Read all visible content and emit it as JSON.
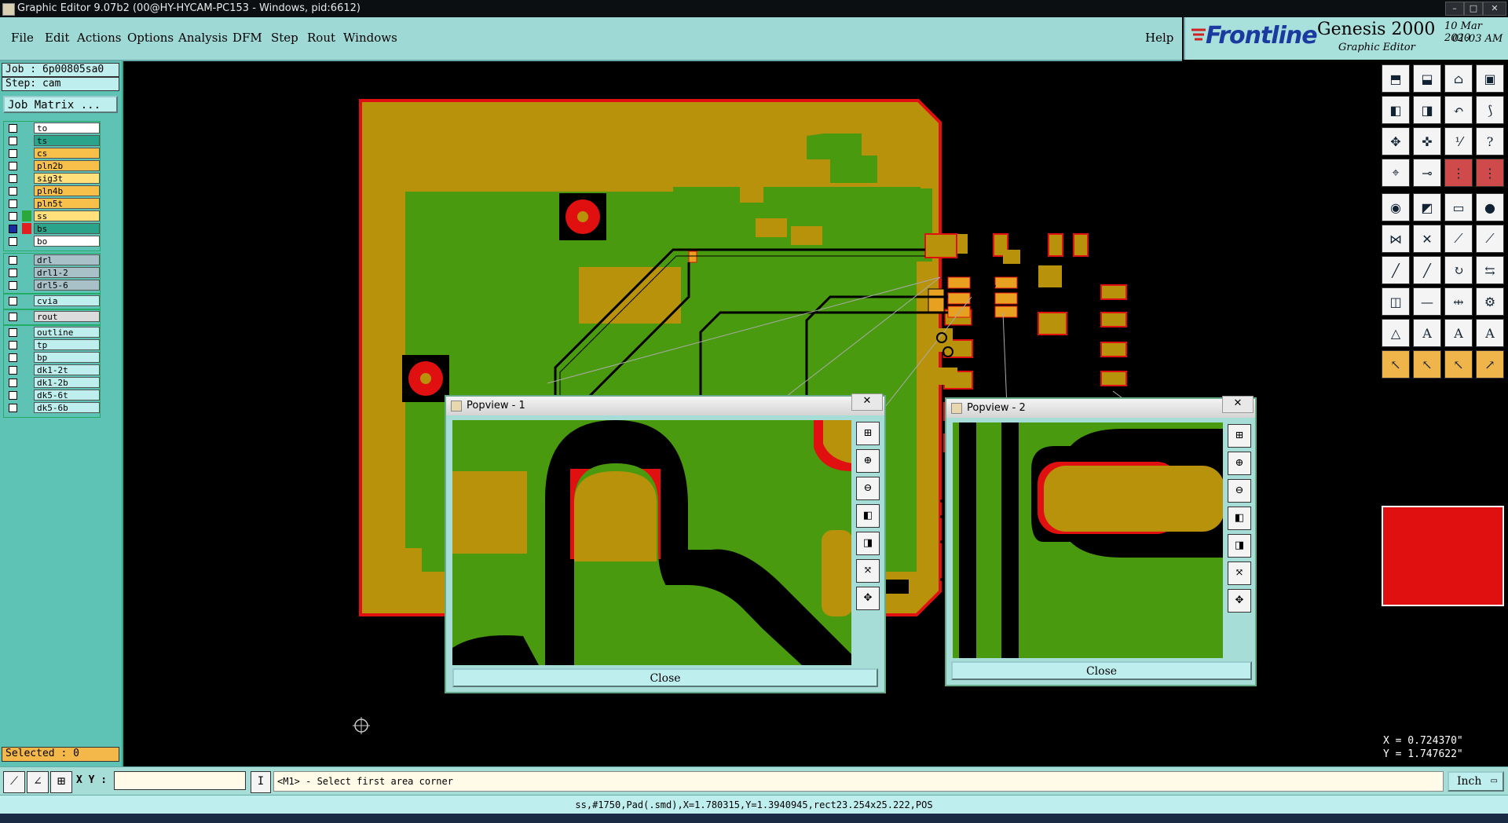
{
  "window_title": "Graphic Editor 9.07b2 (00@HY-HYCAM-PC153 - Windows, pid:6612)",
  "menu": [
    {
      "label": "File"
    },
    {
      "label": "Edit"
    },
    {
      "label": "Actions"
    },
    {
      "label": "Options"
    },
    {
      "label": "Analysis"
    },
    {
      "label": "DFM"
    },
    {
      "label": "Step"
    },
    {
      "label": "Rout"
    },
    {
      "label": "Windows"
    }
  ],
  "help_label": "Help",
  "brand": {
    "logo": "Frontline",
    "product": "Genesis 2000",
    "subtitle": "Graphic Editor",
    "date": "10 Mar 2020",
    "time": "01:03 AM"
  },
  "job": {
    "job_text": "Job : 6p00805sa0",
    "step_text": "Step: cam",
    "matrix_button": "Job Matrix ..."
  },
  "layer_groups": [
    [
      {
        "name": "to",
        "color": "#ffffff",
        "swatch": ""
      },
      {
        "name": "ts",
        "color": "#2aa58c",
        "swatch": ""
      },
      {
        "name": "cs",
        "color": "#f6c04a",
        "swatch": ""
      },
      {
        "name": "pln2b",
        "color": "#f6c04a",
        "swatch": ""
      },
      {
        "name": "sig3t",
        "color": "#ffe07a",
        "swatch": ""
      },
      {
        "name": "pln4b",
        "color": "#f6c04a",
        "swatch": ""
      },
      {
        "name": "pln5t",
        "color": "#f6c04a",
        "swatch": ""
      },
      {
        "name": "ss",
        "color": "#ffe07a",
        "swatch": "#2aa83a"
      },
      {
        "name": "bs",
        "color": "#2aa58c",
        "swatch": "#e02020"
      },
      {
        "name": "bo",
        "color": "#ffffff",
        "swatch": ""
      }
    ],
    [
      {
        "name": "drl",
        "color": "#a8c0c8",
        "swatch": ""
      },
      {
        "name": "drl1-2",
        "color": "#a8c0c8",
        "swatch": ""
      },
      {
        "name": "drl5-6",
        "color": "#a8c0c8",
        "swatch": ""
      }
    ],
    [
      {
        "name": "cvia",
        "color": "#bfeeee",
        "swatch": ""
      }
    ],
    [
      {
        "name": "rout",
        "color": "#dcdcdc",
        "swatch": ""
      }
    ],
    [
      {
        "name": "outline",
        "color": "#bfeeee",
        "swatch": ""
      },
      {
        "name": "tp",
        "color": "#bfeeee",
        "swatch": ""
      },
      {
        "name": "bp",
        "color": "#bfeeee",
        "swatch": ""
      },
      {
        "name": "dk1-2t",
        "color": "#bfeeee",
        "swatch": ""
      },
      {
        "name": "dk1-2b",
        "color": "#bfeeee",
        "swatch": ""
      },
      {
        "name": "dk5-6t",
        "color": "#bfeeee",
        "swatch": ""
      },
      {
        "name": "dk5-6b",
        "color": "#bfeeee",
        "swatch": ""
      }
    ]
  ],
  "selected_text": "Selected : 0",
  "popview1": {
    "title": "Popview - 1",
    "close": "Close"
  },
  "popview2": {
    "title": "Popview - 2",
    "close": "Close"
  },
  "coords": {
    "x": "X = 0.724370\"",
    "y": "Y = 1.747622\""
  },
  "xy_label": "X Y :",
  "prompt": "<M1> - Select first area corner",
  "units": "Inch",
  "status": "ss,#1750,Pad(.smd),X=1.780315,Y=1.3940945,rect23.254x25.222,POS",
  "colors": {
    "board": "#b8920a",
    "copper_green": "#4a9a10",
    "outline_red": "#e01010",
    "panel_teal": "#5ec3b4"
  }
}
